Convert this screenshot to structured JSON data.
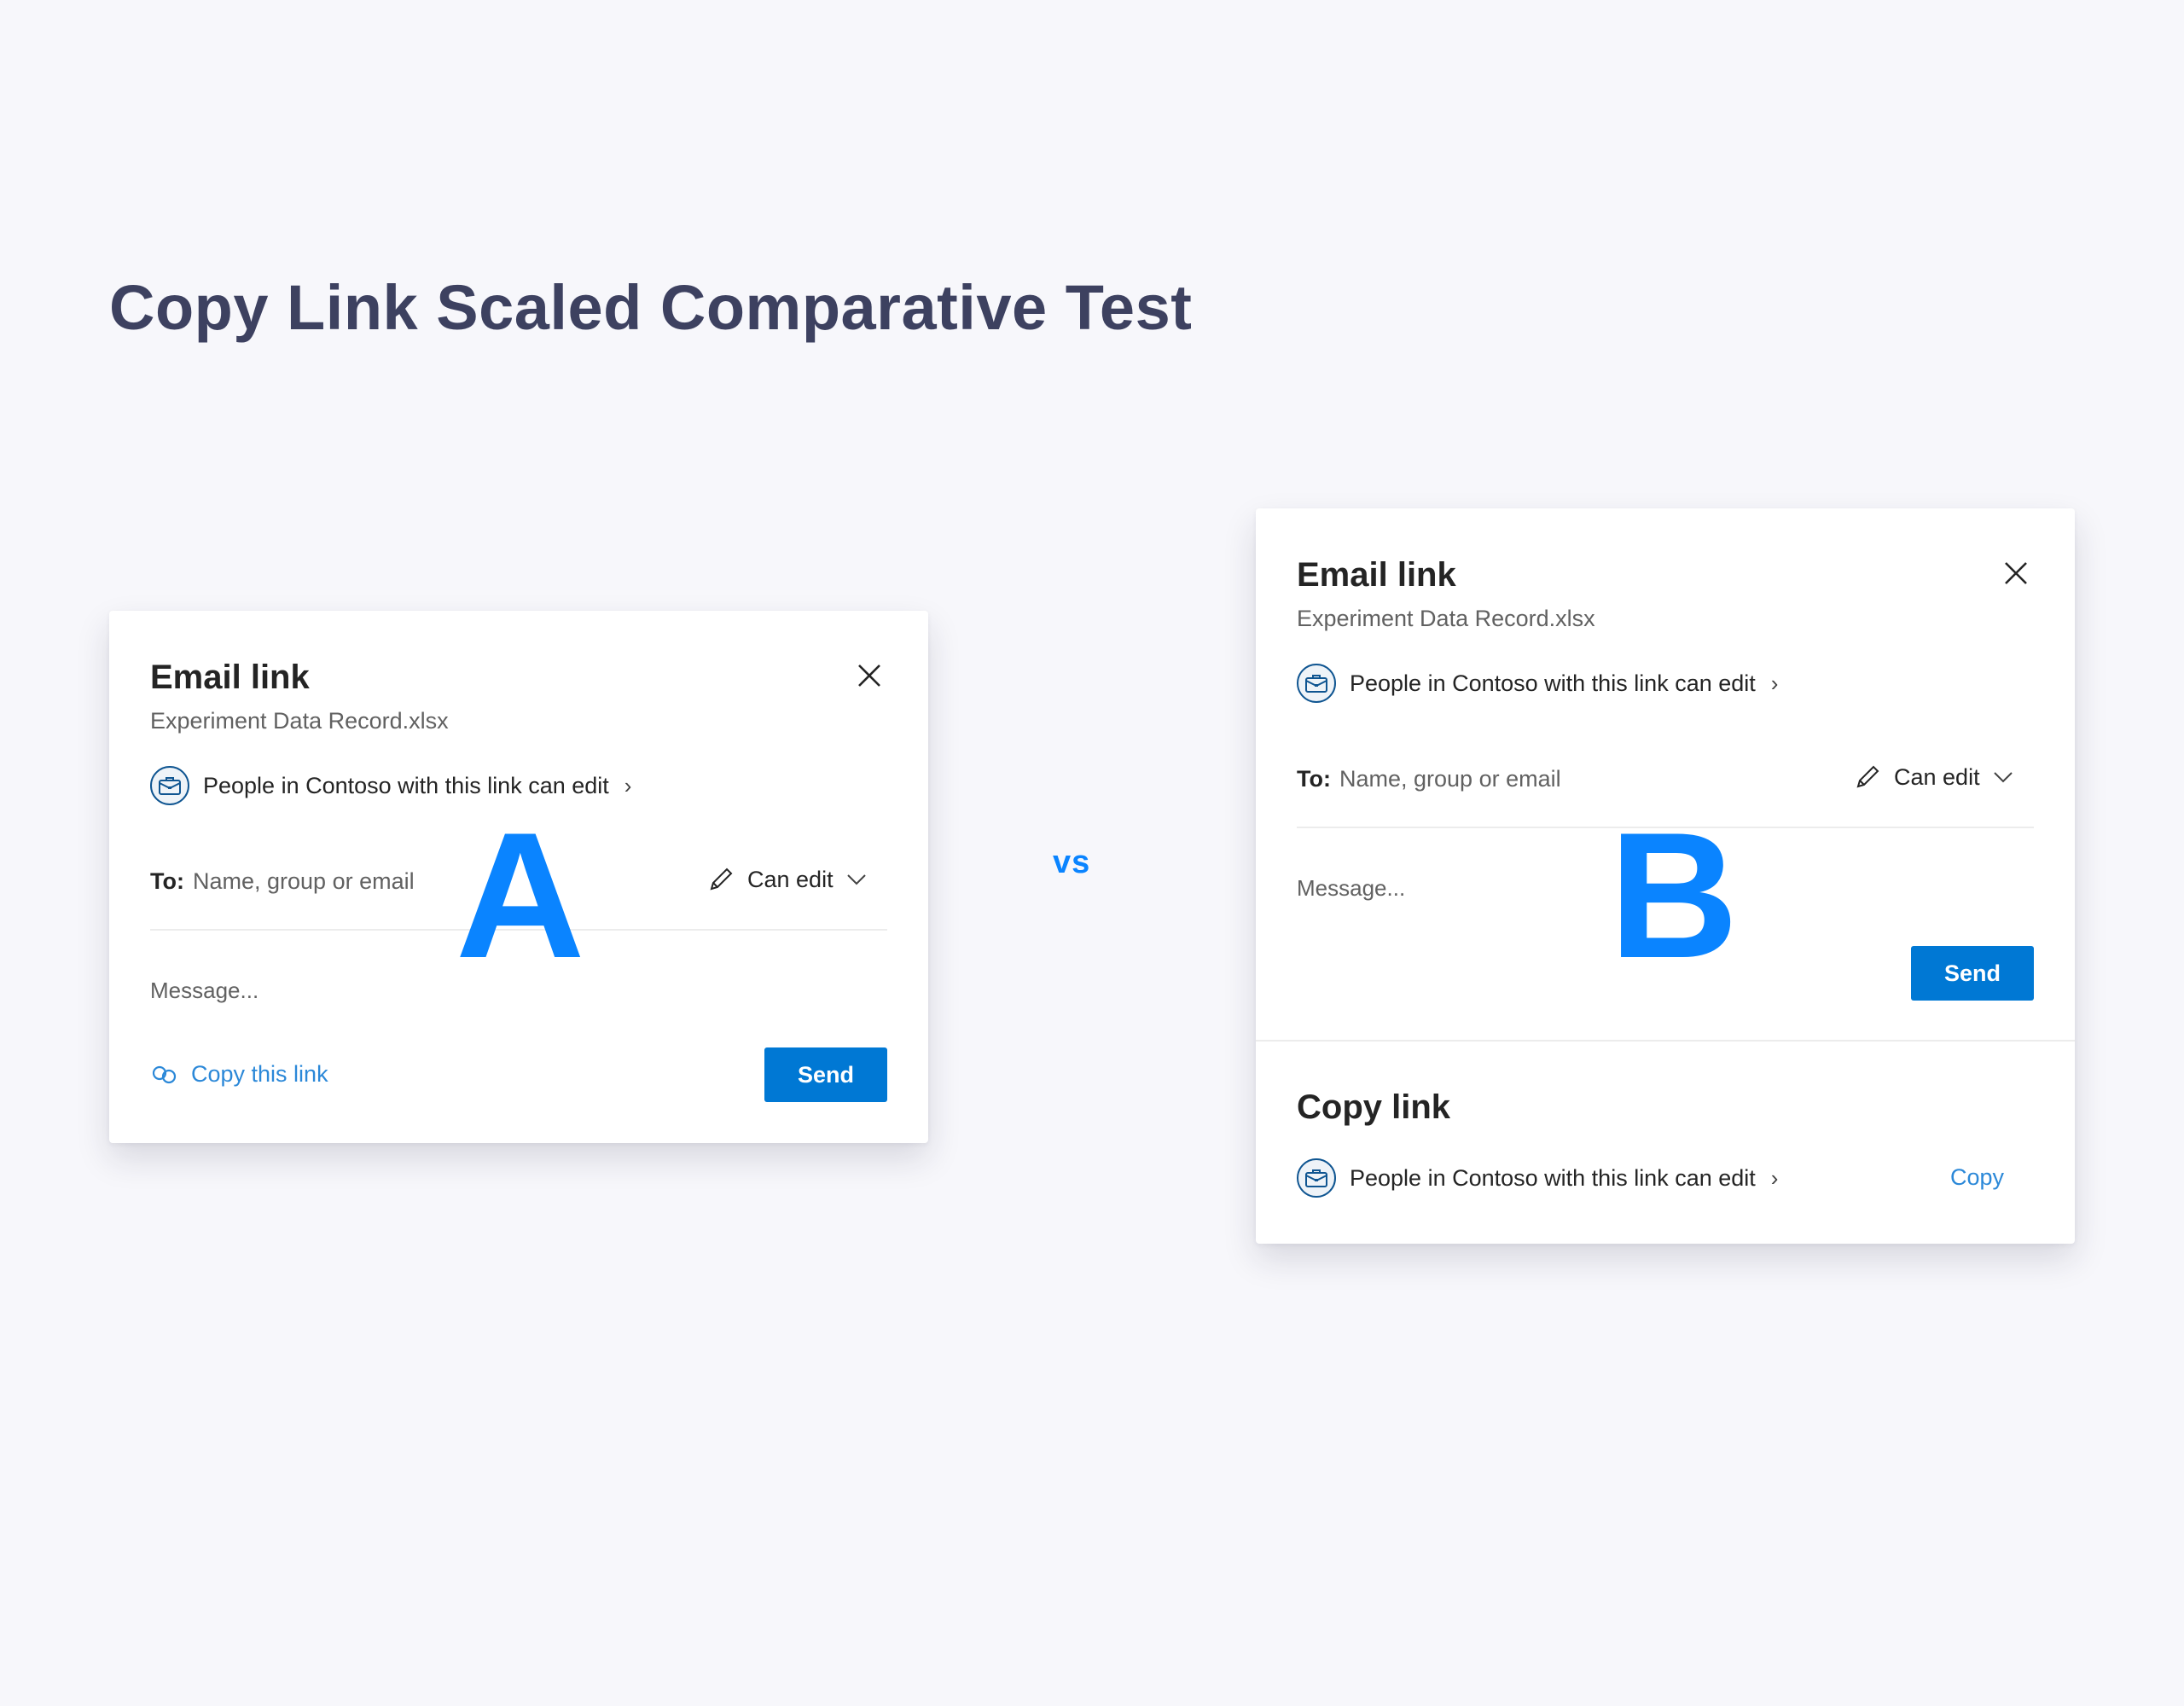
{
  "page": {
    "title": "Copy Link Scaled Comparative Test",
    "vs_label": "vs",
    "accent_color": "#0a84ff"
  },
  "variant_a": {
    "label": "A",
    "dialog_title": "Email link",
    "filename": "Experiment Data Record.xlsx",
    "sharing_scope": "People in Contoso with this link can edit",
    "to_label": "To:",
    "to_placeholder": "Name, group or email",
    "permission": "Can edit",
    "message_placeholder": "Message...",
    "copy_link_label": "Copy this link",
    "send_label": "Send"
  },
  "variant_b": {
    "label": "B",
    "dialog_title": "Email link",
    "filename": "Experiment Data Record.xlsx",
    "sharing_scope": "People in Contoso with this link can edit",
    "to_label": "To:",
    "to_placeholder": "Name, group or email",
    "permission": "Can edit",
    "message_placeholder": "Message...",
    "send_label": "Send",
    "copy_section_title": "Copy link",
    "copy_sharing_scope": "People in Contoso with this link can edit",
    "copy_label": "Copy"
  },
  "icons": {
    "close": "close-icon",
    "briefcase": "briefcase-icon",
    "chevron_right": "chevron-right-icon",
    "pencil": "pencil-icon",
    "chevron_down": "chevron-down-icon",
    "link": "link-icon"
  },
  "colors": {
    "primary_button": "#0078d4",
    "link_text": "#2b88d8",
    "title_text": "#3d4160",
    "background": "#f7f7fb"
  }
}
